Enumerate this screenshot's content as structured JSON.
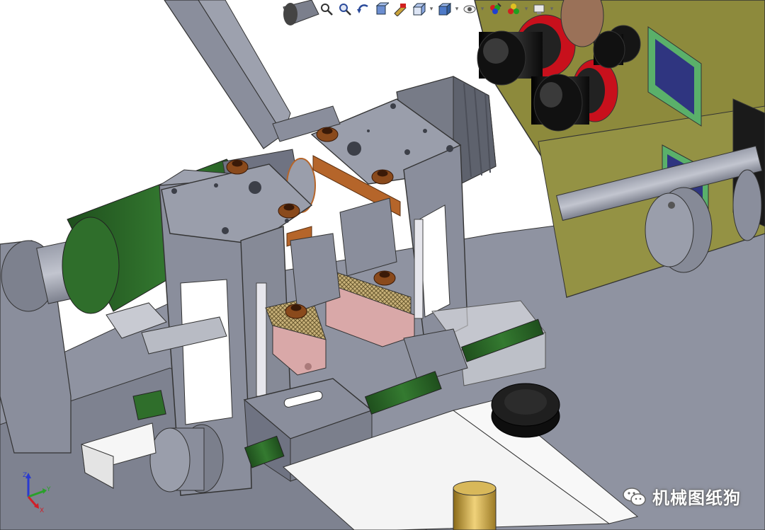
{
  "view": {
    "background": "#ffffff",
    "colors": {
      "steel": "#8a8e9c",
      "steel_dark": "#6f7382",
      "panel_olive": "#8d8a3c",
      "green_cylinder": "#2f6e2b",
      "copper": "#b5652a",
      "black_knob": "#1a1a1a",
      "red_ring": "#c8101c",
      "pink_block": "#d9a8a8",
      "white_rail": "#f4f4f4",
      "brass": "#c9a23a"
    }
  },
  "toolbar": {
    "icons": [
      {
        "name": "zoom-to-fit-icon"
      },
      {
        "name": "zoom-area-icon"
      },
      {
        "name": "previous-view-icon"
      },
      {
        "name": "section-view-icon"
      },
      {
        "name": "dynamic-annotation-icon"
      },
      {
        "name": "view-orientation-icon"
      },
      {
        "name": "display-style-icon"
      },
      {
        "name": "hide-show-items-icon"
      },
      {
        "name": "edit-appearance-icon"
      },
      {
        "name": "apply-scene-icon"
      },
      {
        "name": "view-settings-icon"
      }
    ]
  },
  "triad": {
    "x_label": "X",
    "y_label": "Y",
    "z_label": "Z",
    "x_color": "#d0202a",
    "y_color": "#2aa02a",
    "z_color": "#2a3ad0"
  },
  "watermark": {
    "text": "机械图纸狗",
    "icon": "wechat-icon"
  }
}
